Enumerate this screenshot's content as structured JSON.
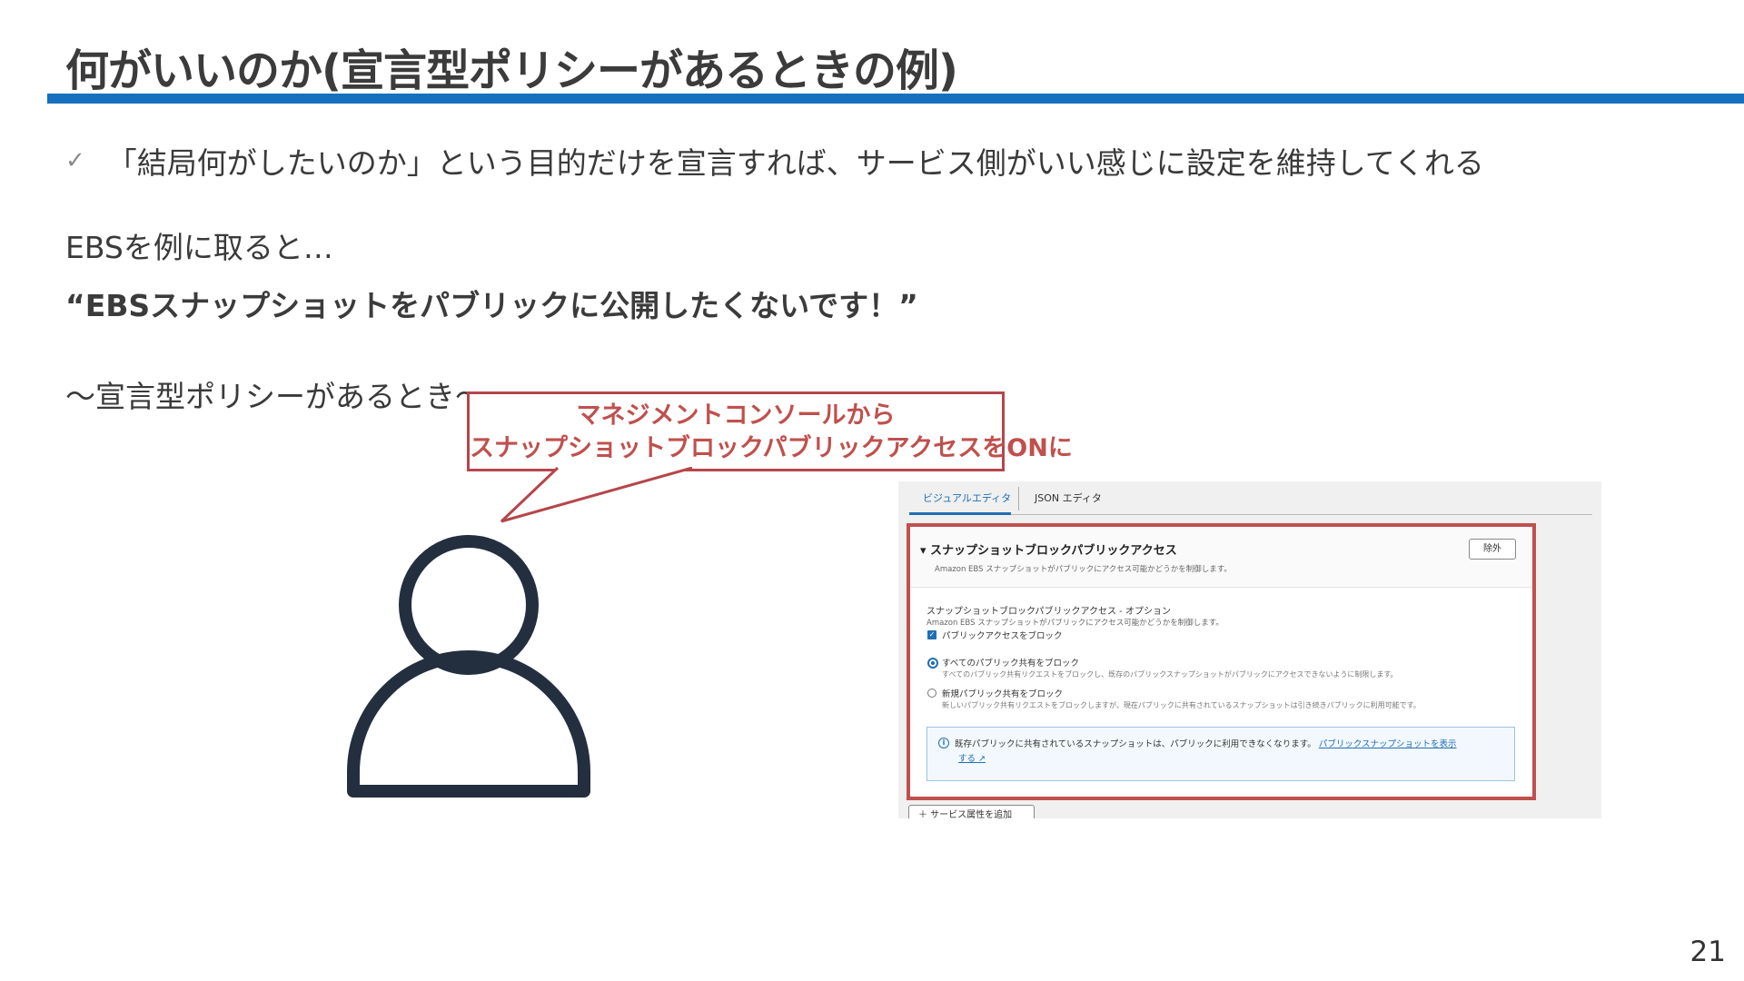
{
  "slide": {
    "title": "何がいいのか(宣言型ポリシーがあるときの例)",
    "accent_color": "#1570be",
    "bullet_icon": "check-icon",
    "bullet_text": "「結局何がしたいのか」という目的だけを宣言すれば、サービス側がいい感じに設定を維持してくれる",
    "ebs_intro": "EBSを例に取ると…",
    "quote": "“EBSスナップショットをパブリックに公開したくないです！”",
    "declarative_heading": "～宣言型ポリシーがあるとき～",
    "page_number": "21"
  },
  "callout": {
    "line1": "マネジメントコンソールから",
    "line2": "スナップショットブロックパブリックアクセスをONに",
    "color": "#c0504d"
  },
  "person_icon": "user-icon",
  "console": {
    "tabs": [
      "ビジュアルエディタ",
      "JSON エディタ"
    ],
    "panel_title": "▾ スナップショットブロックパブリックアクセス",
    "panel_subtitle": "Amazon EBS スナップショットがパブリックにアクセス可能かどうかを制御します。",
    "remove_button": "除外",
    "option_label": "スナップショットブロックパブリックアクセス - オプション",
    "option_desc": "Amazon EBS スナップショットがパブリックにアクセス可能かどうかを制御します。",
    "checkbox_label": "パブリックアクセスをブロック",
    "radio_all_label": "すべてのパブリック共有をブロック",
    "radio_all_desc": "すべてのパブリック共有リクエストをブロックし、既存のパブリックスナップショットがパブリックにアクセスできないように制限します。",
    "radio_new_label": "新規パブリック共有をブロック",
    "radio_new_desc": "新しいパブリック共有リクエストをブロックしますが、現在パブリックに共有されているスナップショットは引き続きパブリックに利用可能です。",
    "info_text": "既存パブリックに共有されているスナップショットは、パブリックに利用できなくなります。",
    "info_link": "パブリックスナップショットを表示",
    "info_link2": "する",
    "add_button": "＋ サービス属性を追加"
  }
}
